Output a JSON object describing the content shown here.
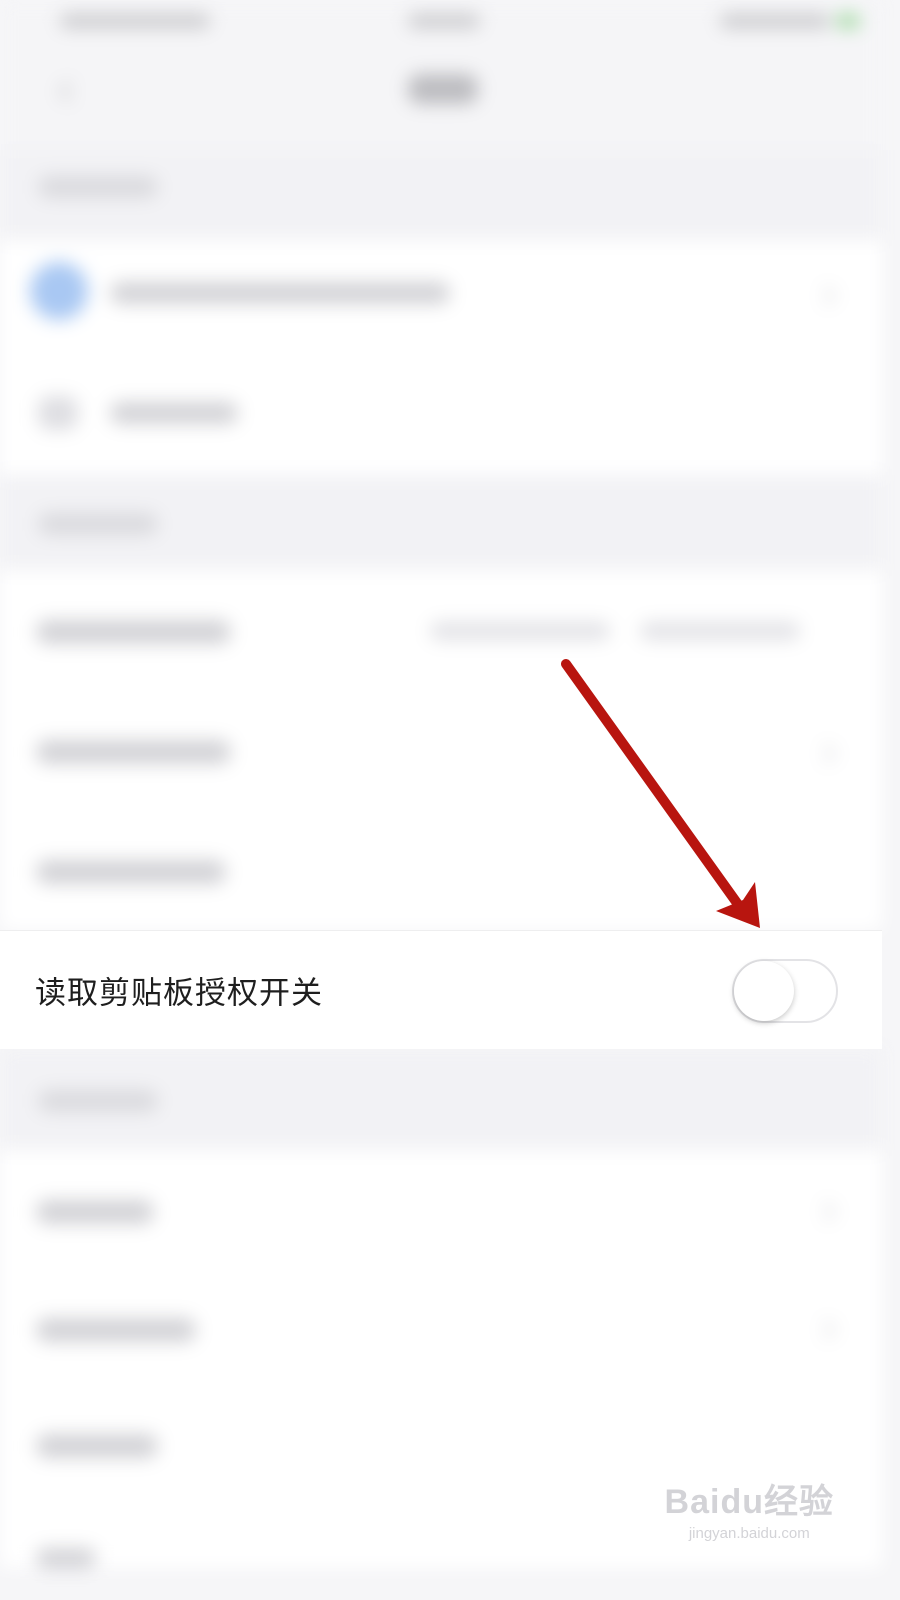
{
  "clipboard_setting": {
    "label": "读取剪贴板授权开关",
    "enabled": false
  },
  "watermark": {
    "logo_text": "Baidu经验",
    "url": "jingyan.baidu.com"
  },
  "colors": {
    "annotation_arrow": "#b8150f",
    "toggle_off_track": "#ffffff",
    "background": "#f6f6f8"
  },
  "icons": {
    "back": "back-icon",
    "chevron": "chevron-right-icon",
    "toggle": "toggle-switch"
  }
}
